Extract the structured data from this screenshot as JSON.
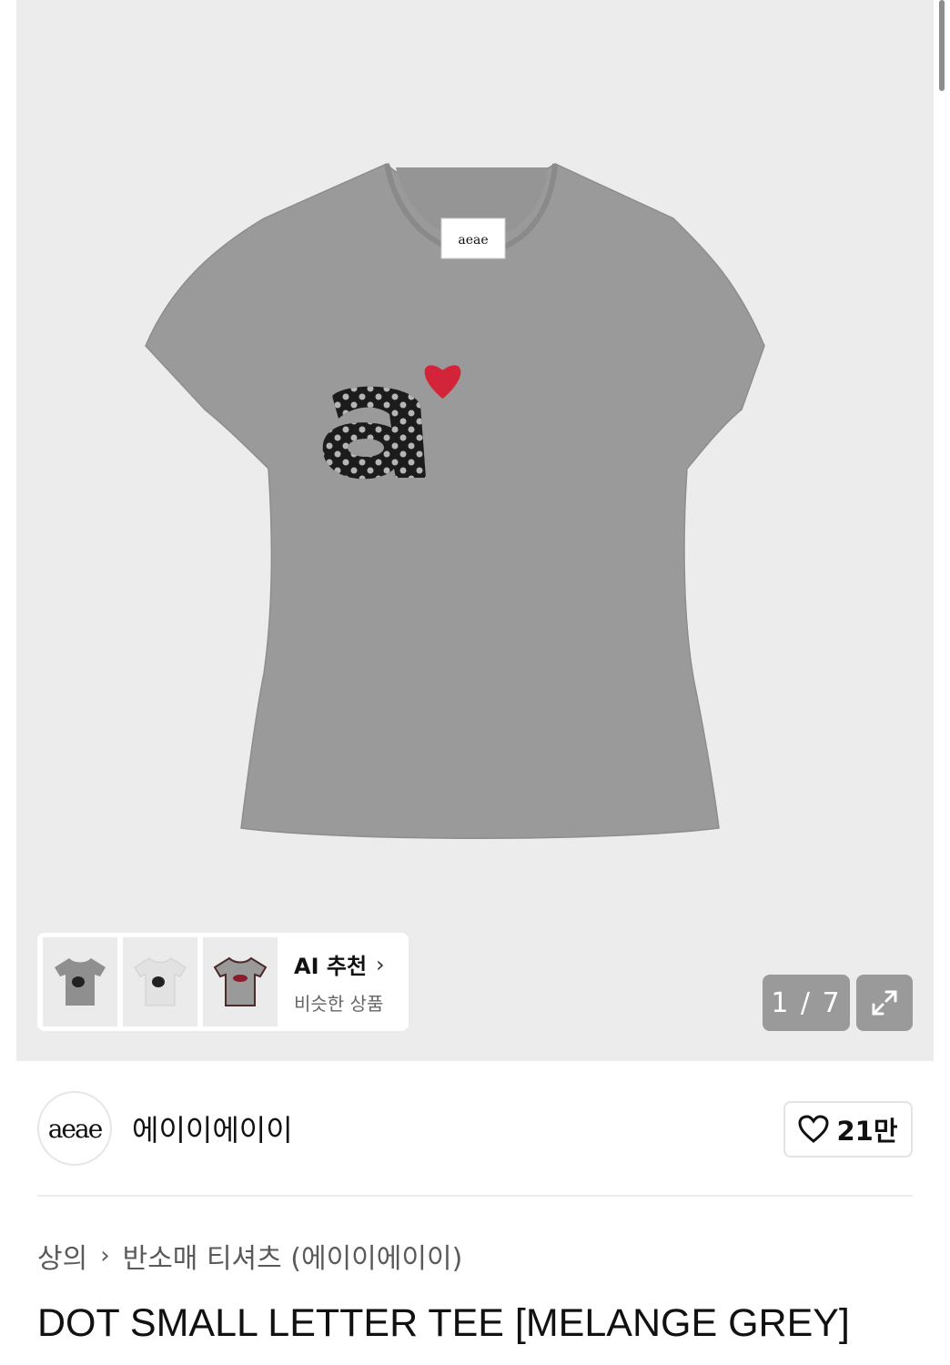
{
  "gallery": {
    "counter": "1 / 7",
    "label_tag": "aeae"
  },
  "ai_recommend": {
    "title": "AI 추천",
    "subtitle": "비슷한 상품"
  },
  "brand": {
    "logo_text": "aeae",
    "name": "에이이에이이"
  },
  "like": {
    "count": "21만"
  },
  "breadcrumb": {
    "level1": "상의",
    "level2": "반소매 티셔츠 (에이이에이이)"
  },
  "product": {
    "title": "DOT SMALL LETTER TEE [MELANGE GREY]"
  },
  "colors": {
    "hero_bg": "#ececec",
    "shirt_grey": "#9a9a9a",
    "heart_red": "#d3243a"
  }
}
